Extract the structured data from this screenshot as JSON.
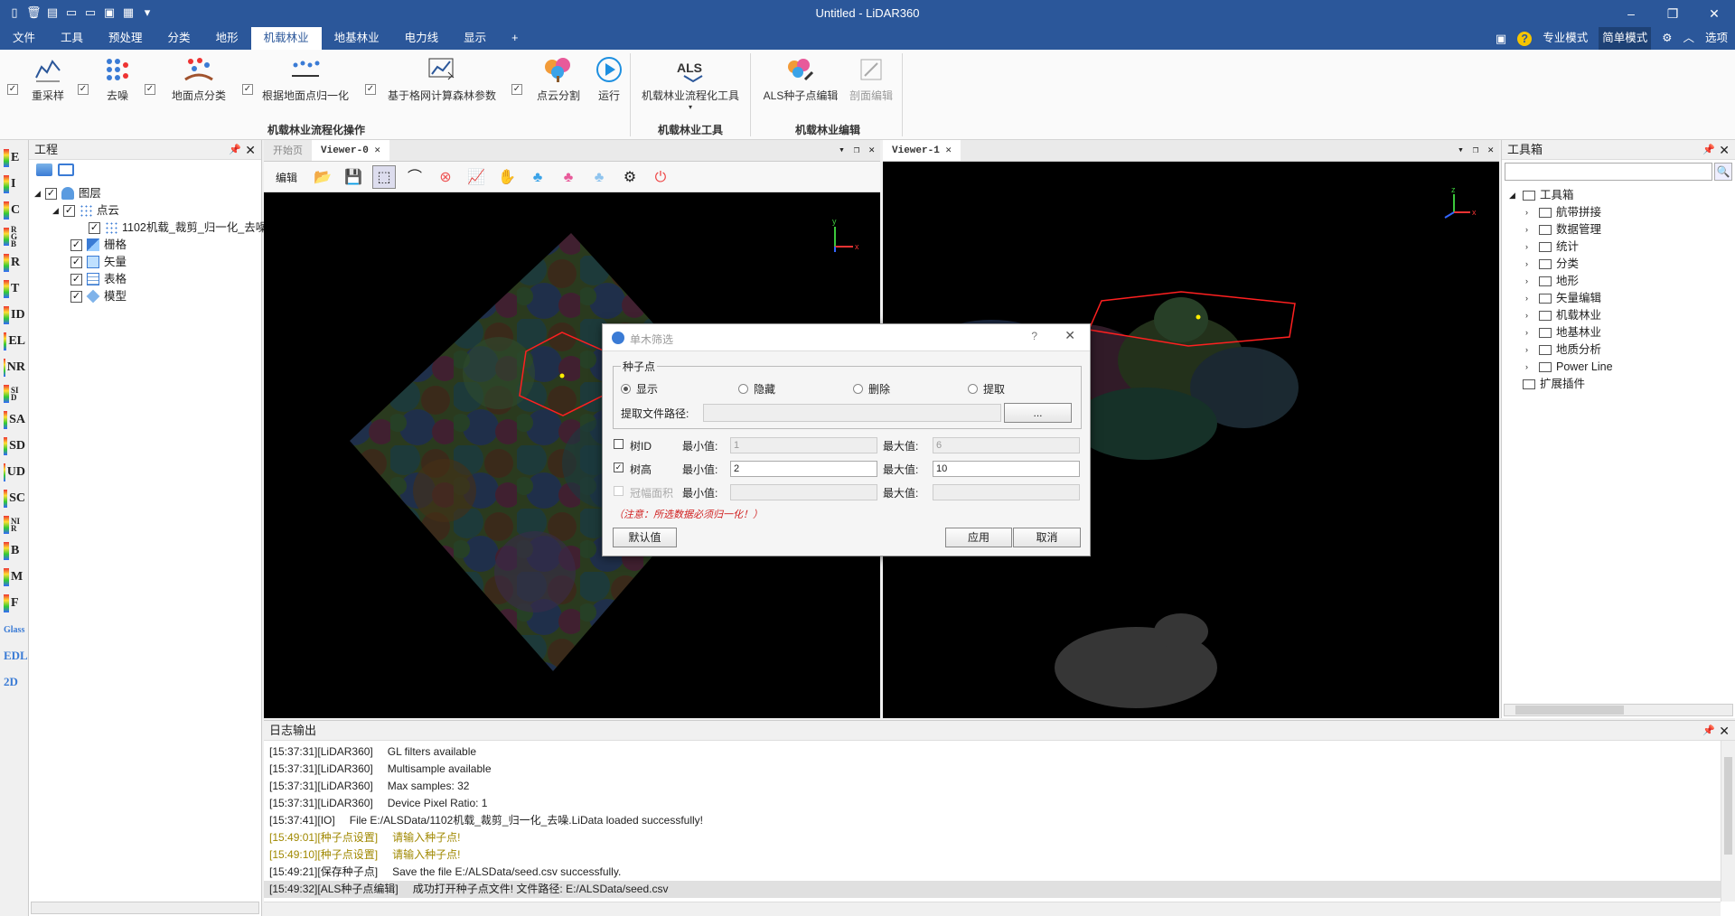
{
  "window": {
    "title": "Untitled - LiDAR360"
  },
  "menu": {
    "tabs": [
      "文件",
      "工具",
      "预处理",
      "分类",
      "地形",
      "机载林业",
      "地基林业",
      "电力线",
      "显示",
      "+"
    ],
    "active_index": 5,
    "right": {
      "pro_mode": "专业模式",
      "simple_mode": "简单模式",
      "options": "选项"
    }
  },
  "ribbon": {
    "buttons": {
      "resample": "重采样",
      "denoise": "去噪",
      "ground_classify": "地面点分类",
      "normalize": "根据地面点归一化",
      "grid_params": "基于格网计算森林参数",
      "segment": "点云分割",
      "run": "运行",
      "als_tools": "机载林业流程化工具",
      "seed_edit": "ALS种子点编辑",
      "profile_edit": "剖面编辑"
    },
    "groups": {
      "workflow": "机载林业流程化操作",
      "tools": "机载林业工具",
      "edit": "机载林业编辑"
    }
  },
  "left_strip": [
    "E",
    "I",
    "C",
    "RGB",
    "R",
    "T",
    "ID",
    "EL",
    "NR",
    "SID",
    "SA",
    "SD",
    "UD",
    "SC",
    "NIR",
    "B",
    "M",
    "F",
    "Glass",
    "EDL",
    "2D"
  ],
  "project": {
    "title": "工程",
    "tree": {
      "layers": "图层",
      "point_cloud": "点云",
      "file": "1102机载_裁剪_归一化_去噪",
      "raster": "栅格",
      "vector": "矢量",
      "table": "表格",
      "model": "模型"
    }
  },
  "viewer0": {
    "tab_start": "开始页",
    "tab_active": "Viewer-0",
    "tool_edit": "编辑"
  },
  "viewer1": {
    "tab_active": "Viewer-1"
  },
  "toolbox": {
    "title": "工具箱",
    "root": "工具箱",
    "items": [
      "航带拼接",
      "数据管理",
      "统计",
      "分类",
      "地形",
      "矢量编辑",
      "机载林业",
      "地基林业",
      "地质分析",
      "Power Line"
    ],
    "extensions": "扩展插件"
  },
  "dialog": {
    "title": "单木筛选",
    "help": "?",
    "seed_group": "种子点",
    "radios": [
      "显示",
      "隐藏",
      "删除",
      "提取"
    ],
    "selected_radio": 0,
    "path_label": "提取文件路径:",
    "path_value": "",
    "browse": "...",
    "rows": [
      {
        "label": "树ID",
        "checked": false,
        "min_label": "最小值:",
        "min": "1",
        "max_label": "最大值:",
        "max": "6",
        "enabled": true,
        "fields_disabled": true
      },
      {
        "label": "树高",
        "checked": true,
        "min_label": "最小值:",
        "min": "2",
        "max_label": "最大值:",
        "max": "10",
        "enabled": true,
        "fields_disabled": false
      },
      {
        "label": "冠幅面积",
        "checked": false,
        "min_label": "最小值:",
        "min": "",
        "max_label": "最大值:",
        "max": "",
        "enabled": false,
        "fields_disabled": true
      }
    ],
    "note": "（注意：所选数据必须归一化！）",
    "default_btn": "默认值",
    "apply_btn": "应用",
    "cancel_btn": "取消"
  },
  "log": {
    "title": "日志输出",
    "lines": [
      {
        "time": "[15:37:31]",
        "src": "[LiDAR360]",
        "msg": "GL filters available",
        "color": "#222"
      },
      {
        "time": "[15:37:31]",
        "src": "[LiDAR360]",
        "msg": "Multisample available",
        "color": "#222"
      },
      {
        "time": "[15:37:31]",
        "src": "[LiDAR360]",
        "msg": "Max samples: 32",
        "color": "#222"
      },
      {
        "time": "[15:37:31]",
        "src": "[LiDAR360]",
        "msg": "Device Pixel Ratio: 1",
        "color": "#222"
      },
      {
        "time": "[15:37:41]",
        "src": "[IO]",
        "msg": "File E:/ALSData/1102机载_裁剪_归一化_去噪.LiData loaded successfully!",
        "color": "#222"
      },
      {
        "time": "[15:49:01]",
        "src": "[种子点设置]",
        "msg": "请输入种子点!",
        "color": "#a08800"
      },
      {
        "time": "[15:49:10]",
        "src": "[种子点设置]",
        "msg": "请输入种子点!",
        "color": "#a08800"
      },
      {
        "time": "[15:49:21]",
        "src": "[保存种子点]",
        "msg": "Save the file E:/ALSData/seed.csv successfully.",
        "color": "#222"
      },
      {
        "time": "[15:49:32]",
        "src": "[ALS种子点编辑]",
        "msg": "成功打开种子点文件! 文件路径: E:/ALSData/seed.csv",
        "color": "#222"
      }
    ]
  },
  "colors": {
    "accent": "#2b579a",
    "selection": "#e0e0e0",
    "warning": "#a08800",
    "polygon": "#ff2020"
  }
}
